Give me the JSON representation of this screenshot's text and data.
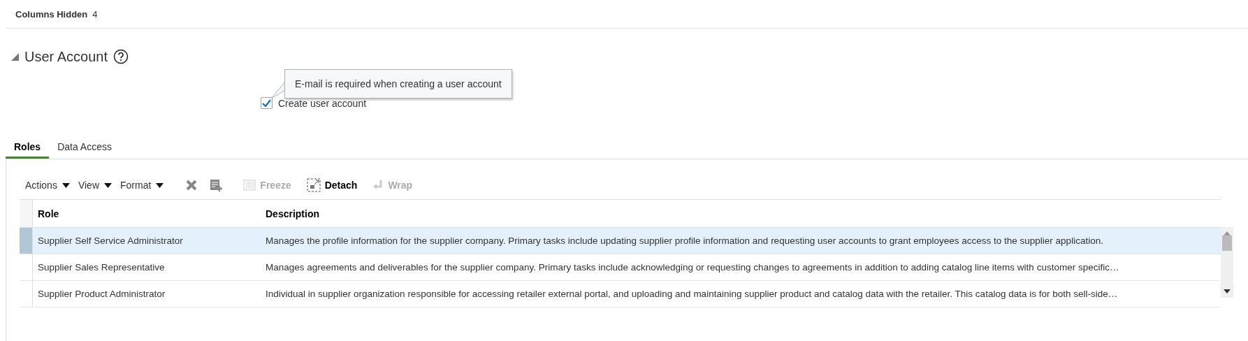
{
  "header": {
    "label": "Columns Hidden",
    "value": "4"
  },
  "section": {
    "title": "User Account",
    "expanded": true
  },
  "tooltip": {
    "text": "E-mail is required when creating a user account"
  },
  "checkbox": {
    "label": "Create user account",
    "checked": true
  },
  "tabs": [
    {
      "label": "Roles",
      "selected": true
    },
    {
      "label": "Data Access",
      "selected": false
    }
  ],
  "toolbar": {
    "menus": [
      {
        "label": "Actions"
      },
      {
        "label": "View"
      },
      {
        "label": "Format"
      }
    ],
    "buttons": [
      {
        "kind": "freeze",
        "label": "Freeze",
        "disabled": true
      },
      {
        "kind": "detach",
        "label": "Detach",
        "disabled": false
      },
      {
        "kind": "wrap",
        "label": "Wrap",
        "disabled": true
      }
    ]
  },
  "table": {
    "columns": [
      "Role",
      "Description"
    ],
    "rows": [
      {
        "role": "Supplier Self Service Administrator",
        "description": "Manages the profile information for the supplier company. Primary tasks include updating supplier profile information and requesting user accounts to grant employees access to the supplier application.",
        "selected": true
      },
      {
        "role": "Supplier Sales Representative",
        "description": "Manages agreements and deliverables for the supplier company. Primary tasks include acknowledging or requesting changes to agreements in addition to adding catalog line items with customer specific…",
        "selected": false
      },
      {
        "role": "Supplier Product Administrator",
        "description": "Individual in supplier organization responsible for accessing retailer external portal, and uploading and maintaining supplier product and catalog data with the retailer. This catalog data is for both sell-side…",
        "selected": false
      }
    ]
  }
}
